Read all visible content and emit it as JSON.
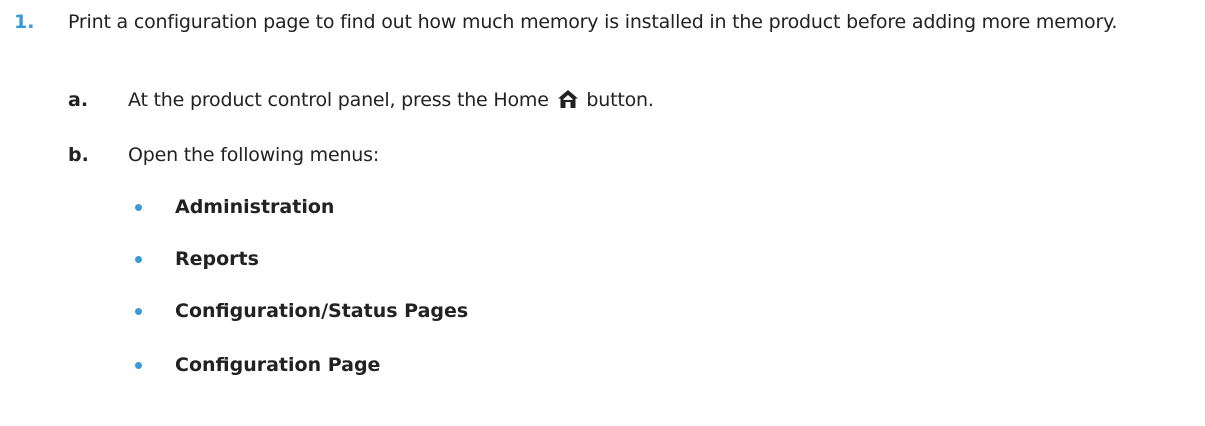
{
  "step": {
    "number": "1.",
    "text": "Print a configuration page to find out how much memory is installed in the product before adding more memory."
  },
  "substeps": [
    {
      "letter": "a.",
      "text_before": "At the product control panel, press the Home",
      "icon": "home-icon",
      "text_after": "button."
    },
    {
      "letter": "b.",
      "text": "Open the following menus:"
    }
  ],
  "menus": [
    "Administration",
    "Reports",
    "Configuration/Status Pages",
    "Configuration Page"
  ],
  "colors": {
    "accent": "#3a9ad9",
    "text": "#222222"
  }
}
